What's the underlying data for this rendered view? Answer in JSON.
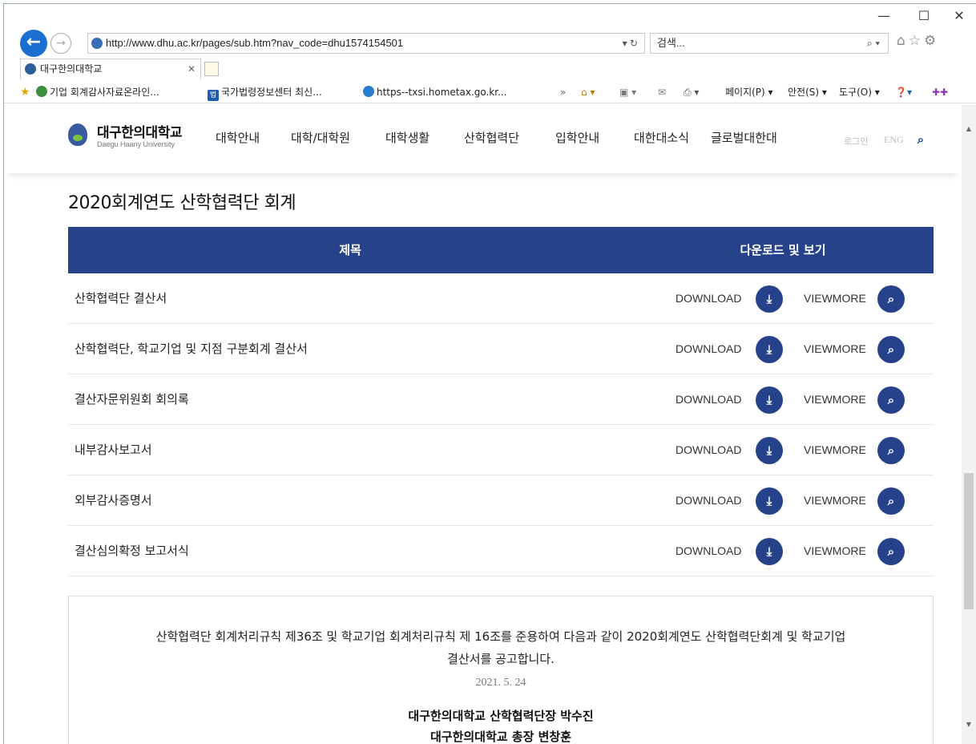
{
  "browser": {
    "url": "http://www.dhu.ac.kr/pages/sub.htm?nav_code=dhu1574154501",
    "search_placeholder": "검색...",
    "tab_title": "대구한의대학교",
    "minimize": "—",
    "maximize": "☐",
    "close": "✕",
    "favorites": [
      "기업 회계감사자료온라인...",
      "국가법령정보센터 최신...",
      "https--txsi.hometax.go.kr..."
    ],
    "toolbar": [
      "페이지(P) ▾",
      "안전(S) ▾",
      "도구(O) ▾"
    ],
    "fav_badge": "법"
  },
  "site": {
    "logo_ko": "대구한의대학교",
    "logo_en": "Daegu Haany University",
    "nav": [
      "대학안내",
      "대학/대학원",
      "대학생활",
      "산학협력단",
      "입학안내",
      "대한대소식",
      "글로벌대한대"
    ],
    "login": "로그인",
    "eng": "ENG"
  },
  "main": {
    "title": "2020회계연도 산학협력단 회계",
    "table": {
      "headers": [
        "제목",
        "다운로드 및 보기"
      ],
      "download_label": "DOWNLOAD",
      "view_label": "VIEWMORE",
      "rows": [
        "산학협력단 결산서",
        "산학협력단, 학교기업 및 지점 구분회계 결산서",
        "결산자문위원회 회의록",
        "내부감사보고서",
        "외부감사증명서",
        "결산심의확정 보고서식"
      ]
    },
    "notice": {
      "line1": "산학협력단 회계처리규칙 제36조 및 학교기업 회계처리규칙 제 16조를 준용하여 다음과 같이 2020회계연도 산학협력단회계 및 학교기업",
      "line2": "결산서를 공고합니다.",
      "date": "2021. 5. 24",
      "signer1": "대구한의대학교 산학협력단장 박수진",
      "signer2": "대구한의대학교 총장 변창훈"
    }
  }
}
